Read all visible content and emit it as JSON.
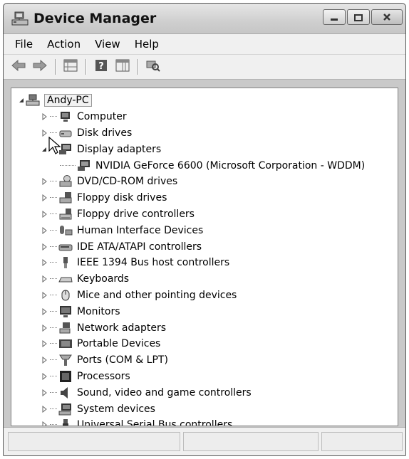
{
  "window": {
    "title": "Device Manager",
    "title_icon": "computer-network-icon"
  },
  "caption": {
    "minimize": "minimize-icon",
    "maximize": "maximize-icon",
    "close": "close-icon"
  },
  "menu": [
    "File",
    "Action",
    "View",
    "Help"
  ],
  "toolbar": [
    "back-icon",
    "forward-icon",
    "properties-grid-icon",
    "help-icon",
    "view-grid-icon",
    "scan-hardware-icon"
  ],
  "tree": {
    "root": "Andy-PC",
    "categories": [
      {
        "label": "Computer",
        "icon": "computer-icon"
      },
      {
        "label": "Disk drives",
        "icon": "disk-drive-icon"
      },
      {
        "label": "Display adapters",
        "icon": "display-adapter-icon",
        "expanded": true,
        "children": [
          {
            "label": "NVIDIA GeForce 6600 (Microsoft Corporation - WDDM)",
            "icon": "display-adapter-icon"
          }
        ]
      },
      {
        "label": "DVD/CD-ROM drives",
        "icon": "dvd-drive-icon"
      },
      {
        "label": "Floppy disk drives",
        "icon": "floppy-drive-icon"
      },
      {
        "label": "Floppy drive controllers",
        "icon": "floppy-controller-icon"
      },
      {
        "label": "Human Interface Devices",
        "icon": "hid-icon"
      },
      {
        "label": "IDE ATA/ATAPI controllers",
        "icon": "ide-controller-icon"
      },
      {
        "label": "IEEE 1394 Bus host controllers",
        "icon": "ieee1394-icon"
      },
      {
        "label": "Keyboards",
        "icon": "keyboard-icon"
      },
      {
        "label": "Mice and other pointing devices",
        "icon": "mouse-icon"
      },
      {
        "label": "Monitors",
        "icon": "monitor-icon"
      },
      {
        "label": "Network adapters",
        "icon": "network-adapter-icon"
      },
      {
        "label": "Portable Devices",
        "icon": "portable-device-icon"
      },
      {
        "label": "Ports (COM & LPT)",
        "icon": "port-icon"
      },
      {
        "label": "Processors",
        "icon": "processor-icon"
      },
      {
        "label": "Sound, video and game controllers",
        "icon": "sound-icon"
      },
      {
        "label": "System devices",
        "icon": "system-device-icon"
      },
      {
        "label": "Universal Serial Bus controllers",
        "icon": "usb-icon"
      }
    ]
  },
  "statusbar": {
    "panels": [
      "",
      "",
      ""
    ]
  }
}
